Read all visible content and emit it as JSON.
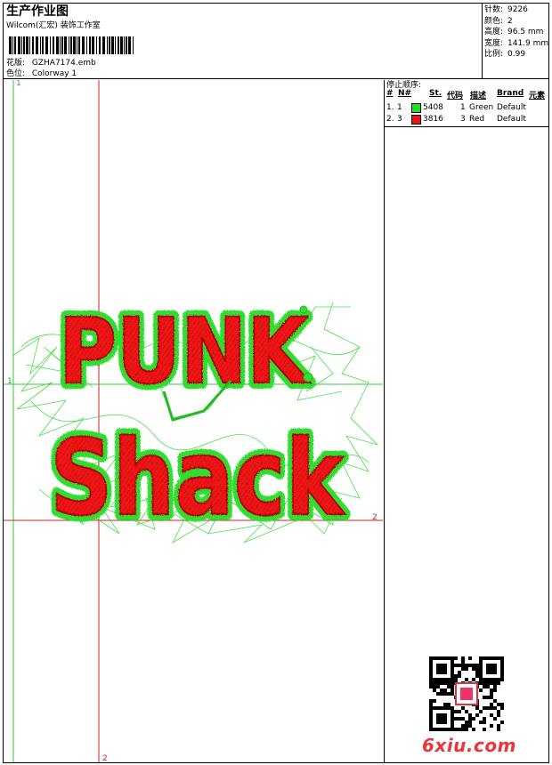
{
  "header": {
    "title": "生产作业图",
    "company": "Wilcom(汇宏) 装饰工作室",
    "design_label": "花版:",
    "design_value": "GZHA7174.emb",
    "colorway_label": "色位:",
    "colorway_value": "Colorway 1"
  },
  "stats": [
    {
      "label": "针数:",
      "value": "9226"
    },
    {
      "label": "颜色:",
      "value": "2"
    },
    {
      "label": "高度:",
      "value": "96.5 mm"
    },
    {
      "label": "宽度:",
      "value": "141.9 mm"
    },
    {
      "label": "比例:",
      "value": "0.99"
    }
  ],
  "stop_sequence": {
    "title": "停止顺序:",
    "headers": [
      "#",
      "N#",
      "St.",
      "代码",
      "描述",
      "Brand",
      "元素"
    ],
    "rows": [
      {
        "num": "1.",
        "n": "1",
        "st": "5408",
        "code": "1",
        "desc": "Green",
        "brand": "Default",
        "color": "#22dd22"
      },
      {
        "num": "2.",
        "n": "3",
        "st": "3816",
        "code": "3",
        "desc": "Red",
        "brand": "Default",
        "color": "#ee1111"
      }
    ]
  },
  "artwork": {
    "line1": "PUNK",
    "line2": "Shack",
    "guide_labels": [
      "1",
      "1",
      "2",
      "2"
    ],
    "thread_colors": {
      "fill": "#ee1515",
      "outline": "#33dd33"
    }
  },
  "watermark": "6xiu.com"
}
